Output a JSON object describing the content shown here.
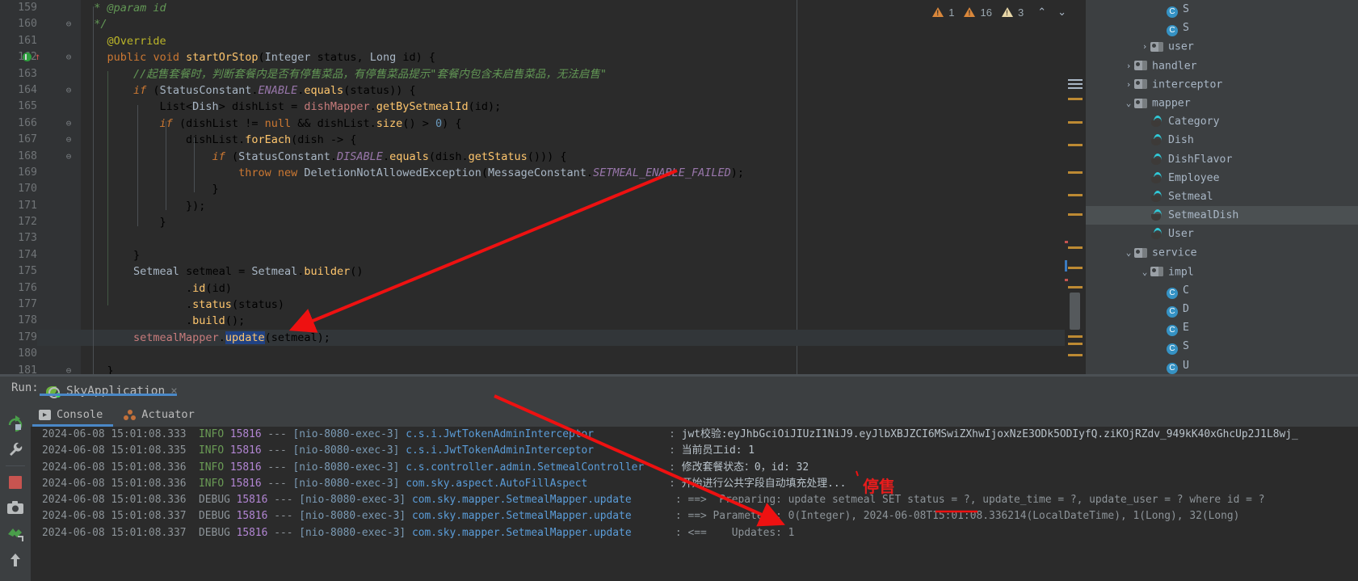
{
  "editor": {
    "lines": [
      {
        "no": "159",
        "code": " * @param id",
        "kind": "javadoc"
      },
      {
        "no": "160",
        "code": " */",
        "kind": "javadoc"
      },
      {
        "no": "161",
        "code": "@Override",
        "kind": "annotation"
      },
      {
        "no": "162",
        "code": "public void startOrStop(Integer status, Long id) {",
        "kind": "signature",
        "breakpoint": true
      },
      {
        "no": "163",
        "code": "//起售套餐时，判断套餐内是否有停售菜品，有停售菜品提示\"套餐内包含未启售菜品，无法启售\"",
        "kind": "comment"
      },
      {
        "no": "164",
        "code": "if (StatusConstant.ENABLE.equals(status)) {",
        "kind": "code"
      },
      {
        "no": "165",
        "code": "List<Dish> dishList = dishMapper.getBySetmealId(id);",
        "kind": "code"
      },
      {
        "no": "166",
        "code": "if (dishList != null && dishList.size() > 0) {",
        "kind": "code"
      },
      {
        "no": "167",
        "code": "dishList.forEach(dish -> {",
        "kind": "code"
      },
      {
        "no": "168",
        "code": "if (StatusConstant.DISABLE.equals(dish.getStatus())) {",
        "kind": "code"
      },
      {
        "no": "169",
        "code": "throw new DeletionNotAllowedException(MessageConstant.SETMEAL_ENABLE_FAILED);",
        "kind": "code"
      },
      {
        "no": "170",
        "code": "}",
        "kind": "code"
      },
      {
        "no": "171",
        "code": "});",
        "kind": "code"
      },
      {
        "no": "172",
        "code": "}",
        "kind": "code"
      },
      {
        "no": "173",
        "code": "",
        "kind": "code"
      },
      {
        "no": "174",
        "code": "}",
        "kind": "code"
      },
      {
        "no": "175",
        "code": "Setmeal setmeal = Setmeal.builder()",
        "kind": "code"
      },
      {
        "no": "176",
        "code": ".id(id)",
        "kind": "code"
      },
      {
        "no": "177",
        "code": ".status(status)",
        "kind": "code"
      },
      {
        "no": "178",
        "code": ".build();",
        "kind": "code"
      },
      {
        "no": "179",
        "code": "setmealMapper.update(setmeal);",
        "kind": "code",
        "highlight": true
      },
      {
        "no": "180",
        "code": "",
        "kind": "code"
      },
      {
        "no": "181",
        "code": "}",
        "kind": "code"
      }
    ]
  },
  "inspections": {
    "warning_count": "1",
    "weak_warning_count": "16",
    "typo_count": "3",
    "prev_label": "⌃",
    "next_label": "⌄"
  },
  "project_tree": {
    "nodes": [
      {
        "indent": 4,
        "arrow": "",
        "icon": "class",
        "label": "S"
      },
      {
        "indent": 4,
        "arrow": "",
        "icon": "class",
        "label": "S"
      },
      {
        "indent": 3,
        "arrow": "›",
        "icon": "folder",
        "label": "user"
      },
      {
        "indent": 2,
        "arrow": "›",
        "icon": "folder",
        "label": "handler"
      },
      {
        "indent": 2,
        "arrow": "›",
        "icon": "folder",
        "label": "interceptor"
      },
      {
        "indent": 2,
        "arrow": "⌄",
        "icon": "folder",
        "label": "mapper"
      },
      {
        "indent": 3,
        "arrow": "",
        "icon": "java",
        "label": "Category"
      },
      {
        "indent": 3,
        "arrow": "",
        "icon": "java",
        "label": "Dish"
      },
      {
        "indent": 3,
        "arrow": "",
        "icon": "java",
        "label": "DishFlavor"
      },
      {
        "indent": 3,
        "arrow": "",
        "icon": "java",
        "label": "Employee"
      },
      {
        "indent": 3,
        "arrow": "",
        "icon": "java",
        "label": "Setmeal"
      },
      {
        "indent": 3,
        "arrow": "",
        "icon": "java",
        "label": "SetmealDish",
        "selected": true
      },
      {
        "indent": 3,
        "arrow": "",
        "icon": "java",
        "label": "User"
      },
      {
        "indent": 2,
        "arrow": "⌄",
        "icon": "folder",
        "label": "service"
      },
      {
        "indent": 3,
        "arrow": "⌄",
        "icon": "folder",
        "label": "impl"
      },
      {
        "indent": 4,
        "arrow": "",
        "icon": "class",
        "label": "C"
      },
      {
        "indent": 4,
        "arrow": "",
        "icon": "class",
        "label": "D"
      },
      {
        "indent": 4,
        "arrow": "",
        "icon": "class",
        "label": "E"
      },
      {
        "indent": 4,
        "arrow": "",
        "icon": "class",
        "label": "S"
      },
      {
        "indent": 4,
        "arrow": "",
        "icon": "class",
        "label": "U"
      }
    ]
  },
  "run_panel": {
    "run_label": "Run:",
    "config_name": "SkyApplication",
    "close_label": "×",
    "tabs": [
      {
        "label": "Console",
        "icon": "console-icon",
        "active": true
      },
      {
        "label": "Actuator",
        "icon": "actuator-icon",
        "active": false
      }
    ],
    "side_buttons": [
      {
        "name": "rerun-button",
        "glyph": "↻"
      },
      {
        "name": "settings-wrench-button",
        "glyph": "⚒"
      },
      {
        "name": "stop-button",
        "glyph": "■"
      },
      {
        "name": "screenshot-button",
        "glyph": "▣"
      },
      {
        "name": "print-button",
        "glyph": "⌘"
      },
      {
        "name": "scroll-up-button",
        "glyph": "↑"
      },
      {
        "name": "scroll-down-button",
        "glyph": "↓"
      }
    ]
  },
  "console_log": [
    {
      "date": "2024-06-08 15:01:08.333",
      "level": "INFO",
      "pid": "15816",
      "thread": "[nio-8080-exec-3]",
      "logger": "c.s.i.JwtTokenAdminInterceptor",
      "message": "jwt校验:eyJhbGciOiJIUzI1NiJ9.eyJlbXBJZCI6MSwiZXhwIjoxNzE3ODk5ODIyfQ.ziKOjRZdv_949kK40xGhcUp2J1L8wj_"
    },
    {
      "date": "2024-06-08 15:01:08.335",
      "level": "INFO",
      "pid": "15816",
      "thread": "[nio-8080-exec-3]",
      "logger": "c.s.i.JwtTokenAdminInterceptor",
      "message": "当前员工id: 1"
    },
    {
      "date": "2024-06-08 15:01:08.336",
      "level": "INFO",
      "pid": "15816",
      "thread": "[nio-8080-exec-3]",
      "logger": "c.s.controller.admin.SetmealController",
      "message": "修改套餐状态：0，id: 32"
    },
    {
      "date": "2024-06-08 15:01:08.336",
      "level": "INFO",
      "pid": "15816",
      "thread": "[nio-8080-exec-3]",
      "logger": "com.sky.aspect.AutoFillAspect",
      "message": "开始进行公共字段自动填充处理..."
    },
    {
      "date": "2024-06-08 15:01:08.336",
      "level": "DEBUG",
      "pid": "15816",
      "thread": "[nio-8080-exec-3]",
      "logger": "com.sky.mapper.SetmealMapper.update",
      "message": "==>  Preparing: update setmeal SET status = ?, update_time = ?, update_user = ? where id = ?"
    },
    {
      "date": "2024-06-08 15:01:08.337",
      "level": "DEBUG",
      "pid": "15816",
      "thread": "[nio-8080-exec-3]",
      "logger": "com.sky.mapper.SetmealMapper.update",
      "message": "==> Parameters: 0(Integer), 2024-06-08T15:01:08.336214(LocalDateTime), 1(Long), 32(Long)"
    },
    {
      "date": "2024-06-08 15:01:08.337",
      "level": "DEBUG",
      "pid": "15816",
      "thread": "[nio-8080-exec-3]",
      "logger": "com.sky.mapper.SetmealMapper.update",
      "message": "<==    Updates: 1"
    }
  ],
  "annotations": {
    "label_text": "停售",
    "color": "#e81c1c"
  }
}
